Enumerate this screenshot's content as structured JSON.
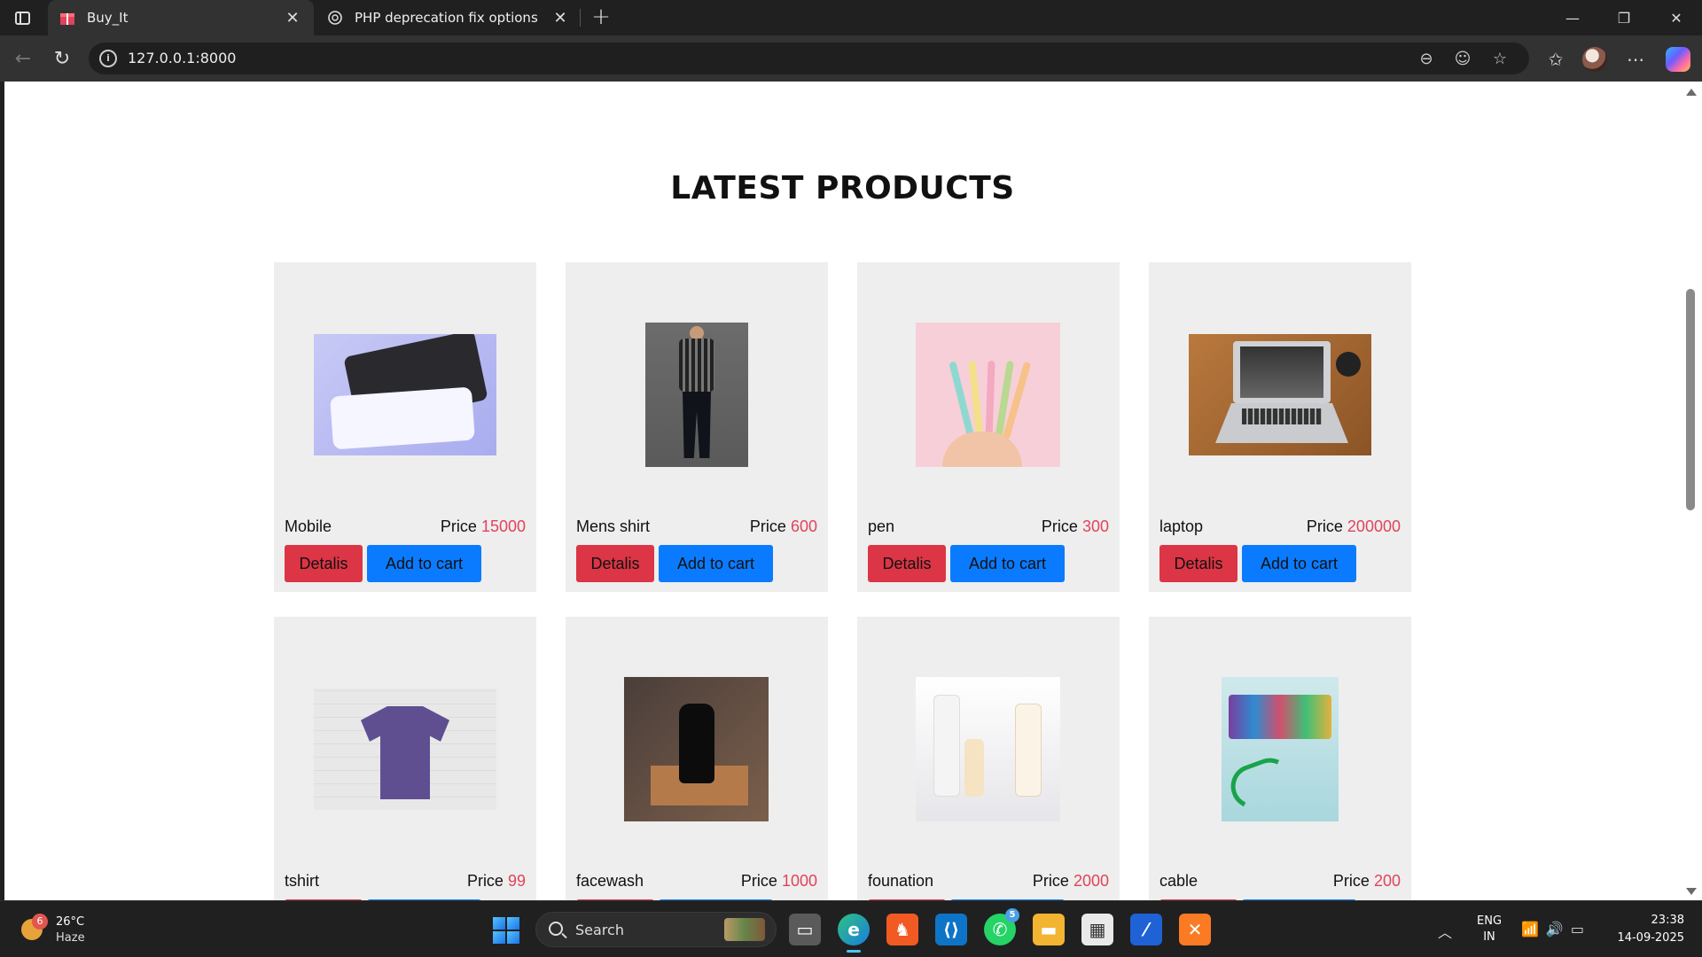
{
  "browser": {
    "tabs": [
      {
        "title": "Buy_It",
        "active": true
      },
      {
        "title": "PHP deprecation fix options",
        "active": false
      }
    ],
    "url": "127.0.0.1:8000"
  },
  "page": {
    "section_title": "LATEST PRODUCTS",
    "price_label": "Price",
    "details_label": "Detalis",
    "cart_label": "Add to cart",
    "products": [
      {
        "name": "Mobile",
        "price": "15000"
      },
      {
        "name": "Mens shirt",
        "price": "600"
      },
      {
        "name": "pen",
        "price": "300"
      },
      {
        "name": "laptop",
        "price": "200000"
      },
      {
        "name": "tshirt",
        "price": "99"
      },
      {
        "name": "facewash",
        "price": "1000"
      },
      {
        "name": "founation",
        "price": "2000"
      },
      {
        "name": "cable",
        "price": "200"
      }
    ],
    "colors": {
      "price_value": "#e0435a",
      "details_button": "#dc3545",
      "cart_button": "#0a7bff",
      "card_bg": "#eeeeee"
    }
  },
  "taskbar": {
    "weather": {
      "temp": "26°C",
      "condition": "Haze",
      "badge": "6"
    },
    "search_label": "Search",
    "whatsapp_badge": "5",
    "language": {
      "line1": "ENG",
      "line2": "IN"
    },
    "time": "23:38",
    "date": "14-09-2025"
  }
}
